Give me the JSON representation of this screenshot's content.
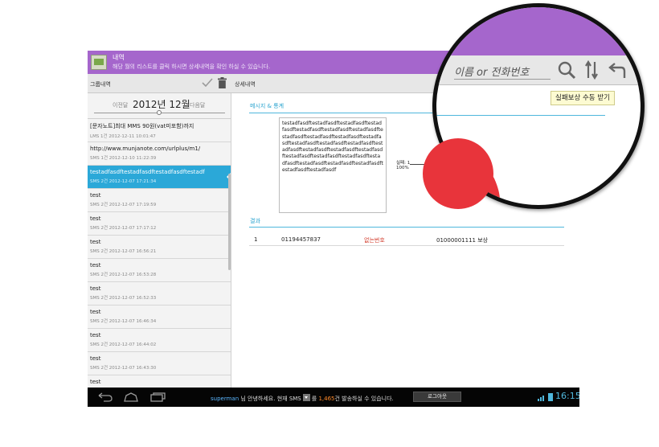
{
  "app": {
    "title": "내역",
    "subtitle": "해당 월의 리스트를 클릭 하시면 상세내역을 확인 하실 수 있습니다."
  },
  "toolbar": {
    "group_label": "그룹내역",
    "detail_label": "상세내역"
  },
  "month_nav": {
    "prev": "이전달",
    "current": "2012년 12월",
    "next": "다음달"
  },
  "messages": [
    {
      "title": "[문자노트]최대 MMS 90원(vat미포함)까지",
      "meta": "LMS 1건 2012-12-11 10:01:47",
      "selected": false
    },
    {
      "title": "http://www.munjanote.com/urlplus/m1/",
      "meta": "SMS 1건 2012-12-10 11:22:39",
      "selected": false
    },
    {
      "title": "testadfasdftestadfasdftestadfasdftestadf",
      "meta": "SMS 2건 2012-12-07 17:21:34",
      "selected": true
    },
    {
      "title": "test",
      "meta": "SMS 2건 2012-12-07 17:19:59",
      "selected": false
    },
    {
      "title": "test",
      "meta": "SMS 2건 2012-12-07 17:17:12",
      "selected": false
    },
    {
      "title": "test",
      "meta": "SMS 2건 2012-12-07 16:56:21",
      "selected": false
    },
    {
      "title": "test",
      "meta": "SMS 2건 2012-12-07 16:53:28",
      "selected": false
    },
    {
      "title": "test",
      "meta": "SMS 2건 2012-12-07 16:52:33",
      "selected": false
    },
    {
      "title": "test",
      "meta": "SMS 2건 2012-12-07 16:46:34",
      "selected": false
    },
    {
      "title": "test",
      "meta": "SMS 2건 2012-12-07 16:44:02",
      "selected": false
    },
    {
      "title": "test",
      "meta": "SMS 2건 2012-12-07 16:43:30",
      "selected": false
    },
    {
      "title": "test",
      "meta": "",
      "selected": false
    }
  ],
  "detail": {
    "section_message": "메시지 & 통계",
    "message_body": "testadfasdftestadfasdftestadfasdftestadfasdftestadfasdftestadfasdftestadfasdftestadfasdftestadfasdftestadfasdftestadfasdftestadfasdftestadfasdftestadfasdftestadfasdftestadfasdftestadfasdftestadfasdftestadfasdftestadfasdftestadfasdftestadfasdftestadfasdftestadfasdftestadfasdftestadfasdftestadfasdf",
    "pie_label_fail": "실패: 1",
    "pie_label_pct": "100%",
    "section_result": "결과",
    "result": {
      "no": "1",
      "phone": "01194457837",
      "status": "없는번호",
      "target": "01000001111",
      "action": "보상"
    }
  },
  "status_bar": {
    "user": "superman",
    "greeting": "님 안녕하세요. 현재",
    "sms": "SMS",
    "mid": "를",
    "count": "1,465",
    "tail": "건 발송하실 수 있습니다.",
    "logout": "로그아웃",
    "time": "16:15"
  },
  "magnifier": {
    "search_placeholder": "이름 or 전화번호",
    "compensate_button": "실패보상 수동 받기"
  },
  "colors": {
    "accent_purple": "#a566cc",
    "selection_blue": "#2ba8d8",
    "section_blue": "#29a3cf",
    "pie_red": "#e8343b",
    "status_red": "#d23b2b",
    "count_orange": "#ff8a2a"
  },
  "chart_data": {
    "type": "pie",
    "categories": [
      "실패"
    ],
    "values": [
      1
    ],
    "labels": [
      "실패: 1",
      "100%"
    ]
  }
}
